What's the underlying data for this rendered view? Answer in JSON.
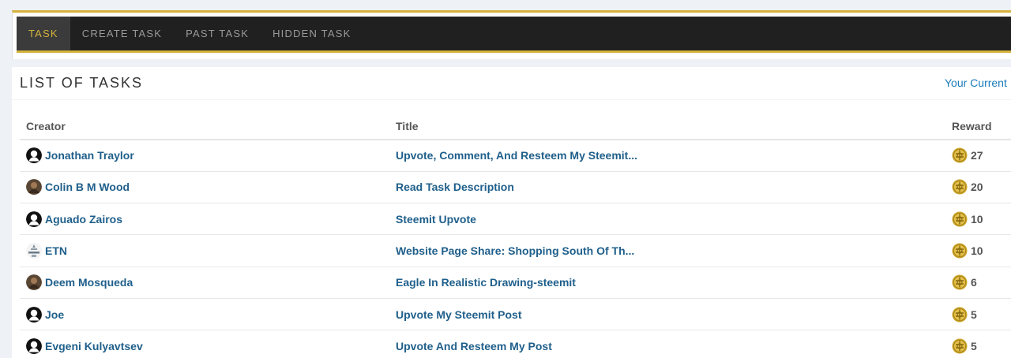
{
  "nav": {
    "tabs": [
      {
        "label": "TASK",
        "active": true
      },
      {
        "label": "CREATE TASK",
        "active": false
      },
      {
        "label": "PAST TASK",
        "active": false
      },
      {
        "label": "HIDDEN TASK",
        "active": false
      }
    ]
  },
  "panel": {
    "title": "LIST OF TASKS",
    "link": "Your Current"
  },
  "table": {
    "headers": {
      "creator": "Creator",
      "title": "Title",
      "reward": "Reward"
    },
    "rows": [
      {
        "creator": "Jonathan Traylor",
        "avatar": "default-user-icon",
        "title": "Upvote, Comment, And Resteem My Steemit...",
        "reward": "27"
      },
      {
        "creator": "Colin B M Wood",
        "avatar": "photo-avatar",
        "title": "Read Task Description",
        "reward": "20"
      },
      {
        "creator": "Aguado Zairos",
        "avatar": "default-user-icon",
        "title": "Steemit Upvote",
        "reward": "10"
      },
      {
        "creator": "ETN",
        "avatar": "logo-avatar",
        "title": "Website Page Share: Shopping South Of Th...",
        "reward": "10"
      },
      {
        "creator": "Deem Mosqueda",
        "avatar": "photo-avatar",
        "title": "Eagle In Realistic Drawing-steemit",
        "reward": "6"
      },
      {
        "creator": "Joe",
        "avatar": "default-user-icon",
        "title": "Upvote My Steemit Post",
        "reward": "5"
      },
      {
        "creator": "Evgeni Kulyavtsev",
        "avatar": "default-user-icon",
        "title": "Upvote And Resteem My Post",
        "reward": "5"
      }
    ]
  },
  "colors": {
    "accent": "#d4b23c",
    "navbar": "#202020",
    "link": "#1f5f8b",
    "coin": "#c9a227"
  },
  "icons": {
    "coin": "gold-coin-icon"
  }
}
